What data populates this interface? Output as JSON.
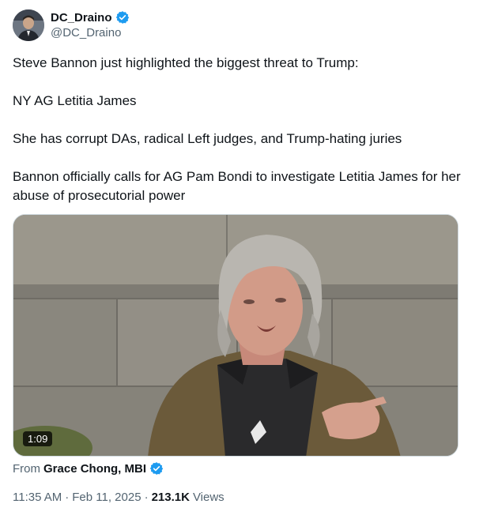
{
  "author": {
    "display_name": "DC_Draino",
    "handle": "@DC_Draino",
    "verified_color": "#1d9bf0"
  },
  "tweet": {
    "paragraphs": [
      "Steve Bannon just highlighted the biggest threat to Trump:",
      "NY AG Letitia James",
      "She has corrupt DAs, radical Left judges, and Trump-hating juries",
      "Bannon officially calls for AG Pam Bondi to investigate Letitia James for her abuse of prosecutorial power"
    ]
  },
  "media": {
    "type": "video",
    "duration": "1:09"
  },
  "attribution": {
    "from_label": "From",
    "source_name": "Grace Chong, MBI"
  },
  "meta": {
    "time": "11:35 AM",
    "separator": "·",
    "date": "Feb 11, 2025",
    "views_count": "213.1K",
    "views_label": "Views"
  },
  "colors": {
    "text_primary": "#0f1419",
    "text_secondary": "#536471",
    "accent": "#1d9bf0"
  }
}
